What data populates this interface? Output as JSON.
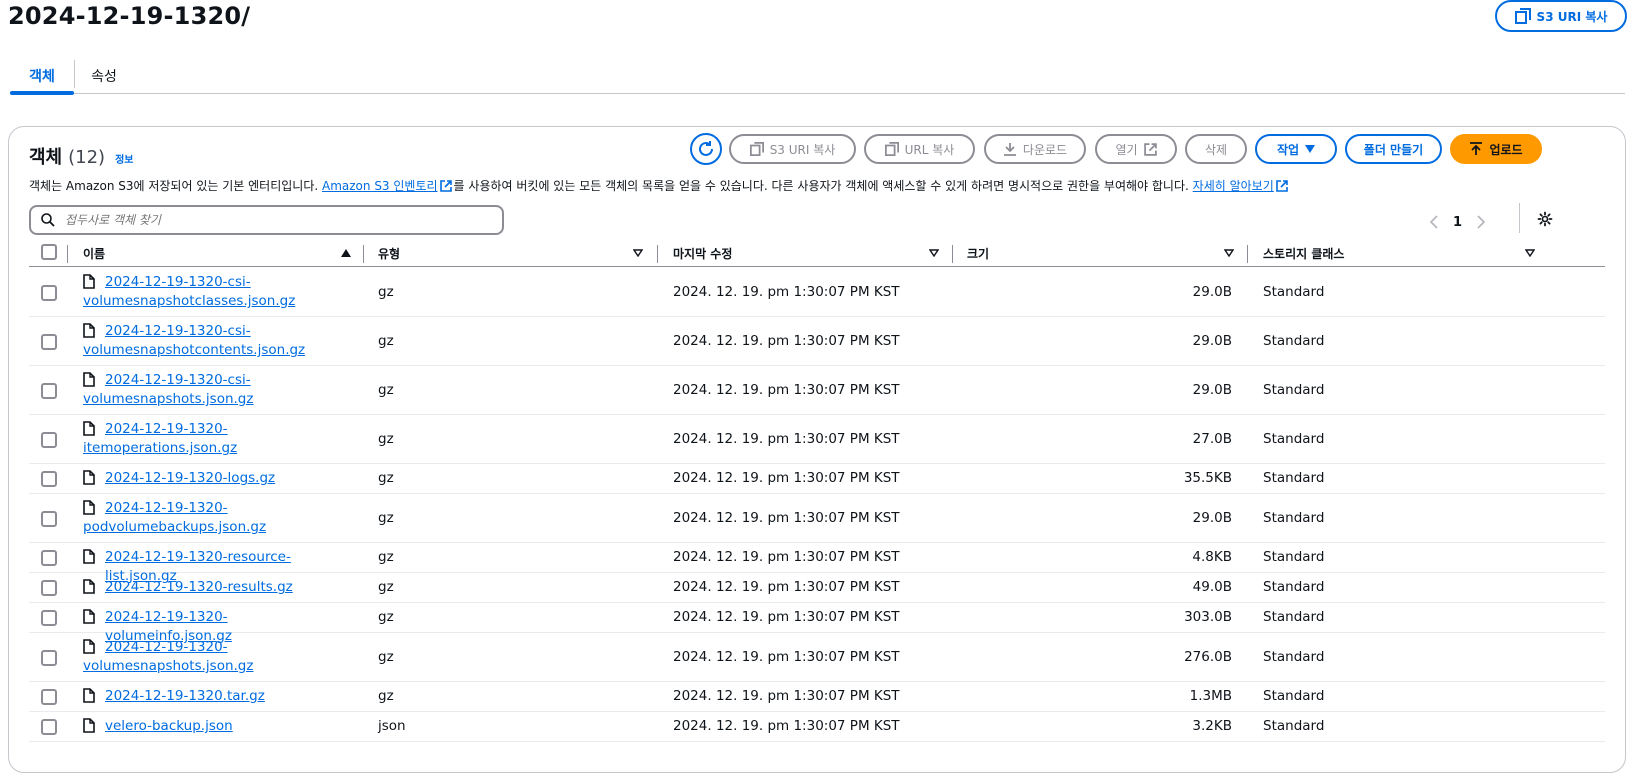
{
  "page": {
    "title": "2024-12-19-1320/",
    "copy_uri_top_label": "S3 URI 복사"
  },
  "tabs": [
    {
      "label": "객체",
      "active": true
    },
    {
      "label": "속성",
      "active": false
    }
  ],
  "panel": {
    "title": "객체",
    "count": "(12)",
    "info_label": "정보",
    "desc_part1": "객체는 Amazon S3에 저장되어 있는 기본 엔터티입니다. ",
    "desc_link1": "Amazon S3 인벤토리",
    "desc_part2": "를 사용하여 버킷에 있는 모든 객체의 목록을 얻을 수 있습니다. 다른 사용자가 객체에 액세스할 수 있게 하려면 명시적으로 권한을 부여해야 합니다. ",
    "desc_link2": "자세히 알아보기"
  },
  "actions": {
    "copy_s3_uri": "S3 URI 복사",
    "copy_url": "URL 복사",
    "download": "다운로드",
    "open": "열기",
    "delete": "삭제",
    "actions_menu": "작업",
    "create_folder": "폴더 만들기",
    "upload": "업로드"
  },
  "search": {
    "placeholder": "접두사로 객체 찾기",
    "value": ""
  },
  "pagination": {
    "current_page": "1"
  },
  "table": {
    "columns": [
      "이름",
      "유형",
      "마지막 수정",
      "크기",
      "스토리지 클래스"
    ],
    "rows": [
      {
        "name_line1": "2024-12-19-1320-csi-",
        "name_line2": "volumesnapshotclasses.json.gz",
        "type": "gz",
        "modified": "2024. 12. 19. pm 1:30:07 PM KST",
        "size": "29.0B",
        "storage": "Standard"
      },
      {
        "name_line1": "2024-12-19-1320-csi-",
        "name_line2": "volumesnapshotcontents.json.gz",
        "type": "gz",
        "modified": "2024. 12. 19. pm 1:30:07 PM KST",
        "size": "29.0B",
        "storage": "Standard"
      },
      {
        "name_line1": "2024-12-19-1320-csi-",
        "name_line2": "volumesnapshots.json.gz",
        "type": "gz",
        "modified": "2024. 12. 19. pm 1:30:07 PM KST",
        "size": "29.0B",
        "storage": "Standard"
      },
      {
        "name_line1": "2024-12-19-1320-",
        "name_line2": "itemoperations.json.gz",
        "type": "gz",
        "modified": "2024. 12. 19. pm 1:30:07 PM KST",
        "size": "27.0B",
        "storage": "Standard"
      },
      {
        "name_line1": "2024-12-19-1320-logs.gz",
        "name_line2": "",
        "type": "gz",
        "modified": "2024. 12. 19. pm 1:30:07 PM KST",
        "size": "35.5KB",
        "storage": "Standard"
      },
      {
        "name_line1": "2024-12-19-1320-",
        "name_line2": "podvolumebackups.json.gz",
        "type": "gz",
        "modified": "2024. 12. 19. pm 1:30:07 PM KST",
        "size": "29.0B",
        "storage": "Standard"
      },
      {
        "name_line1": "2024-12-19-1320-resource-list.json.gz",
        "name_line2": "",
        "type": "gz",
        "modified": "2024. 12. 19. pm 1:30:07 PM KST",
        "size": "4.8KB",
        "storage": "Standard"
      },
      {
        "name_line1": "2024-12-19-1320-results.gz",
        "name_line2": "",
        "type": "gz",
        "modified": "2024. 12. 19. pm 1:30:07 PM KST",
        "size": "49.0B",
        "storage": "Standard"
      },
      {
        "name_line1": "2024-12-19-1320-volumeinfo.json.gz",
        "name_line2": "",
        "type": "gz",
        "modified": "2024. 12. 19. pm 1:30:07 PM KST",
        "size": "303.0B",
        "storage": "Standard"
      },
      {
        "name_line1": "2024-12-19-1320-",
        "name_line2": "volumesnapshots.json.gz",
        "type": "gz",
        "modified": "2024. 12. 19. pm 1:30:07 PM KST",
        "size": "276.0B",
        "storage": "Standard"
      },
      {
        "name_line1": "2024-12-19-1320.tar.gz",
        "name_line2": "",
        "type": "gz",
        "modified": "2024. 12. 19. pm 1:30:07 PM KST",
        "size": "1.3MB",
        "storage": "Standard"
      },
      {
        "name_line1": "velero-backup.json",
        "name_line2": "",
        "type": "json",
        "modified": "2024. 12. 19. pm 1:30:07 PM KST",
        "size": "3.2KB",
        "storage": "Standard"
      }
    ]
  }
}
